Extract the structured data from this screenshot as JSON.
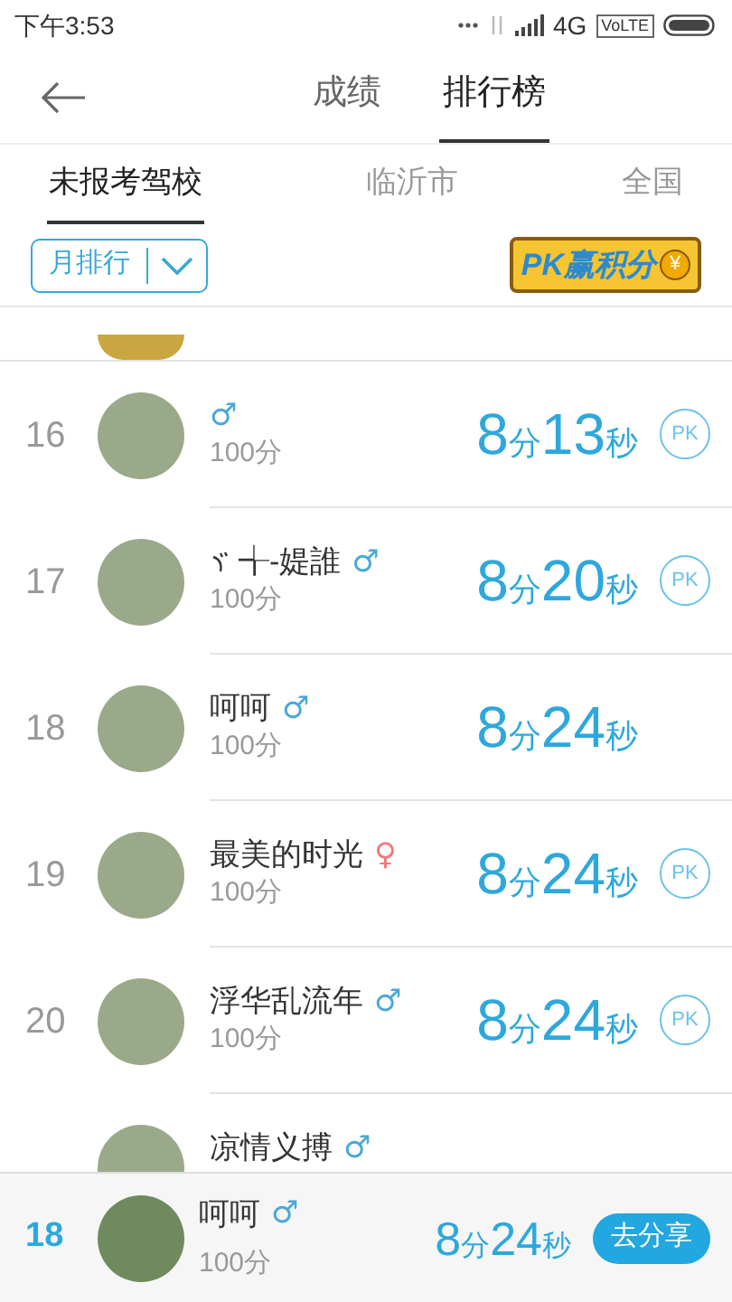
{
  "status_bar": {
    "time": "下午3:53",
    "network": "4G",
    "volte": "VoLTE"
  },
  "header": {
    "tabs": [
      {
        "label": "成绩",
        "selected": false
      },
      {
        "label": "排行榜",
        "selected": true
      }
    ]
  },
  "scope_tabs": [
    {
      "label": "未报考驾校",
      "selected": true
    },
    {
      "label": "临沂市",
      "selected": false
    },
    {
      "label": "全国",
      "selected": false
    }
  ],
  "filter": {
    "label": "月排行"
  },
  "promo": {
    "text": "PK赢积分",
    "coin": "¥"
  },
  "rows": [
    {
      "rank": "16",
      "gender": {
        "symbol": "♂",
        "color": "#4aa8d8"
      },
      "score": "100分",
      "time": "8分13秒",
      "pk": "PK"
    },
    {
      "rank": "17",
      "name_symbol": true,
      "name": "╅-媞誰",
      "gender": {
        "symbol": "♂",
        "color": "#4aa8d8"
      },
      "score": "100分",
      "time": "8分20秒",
      "pk": "PK"
    },
    {
      "rank": "18",
      "name": "呵呵",
      "gender": {
        "symbol": "♂",
        "color": "#4aa8d8"
      },
      "score": "100分",
      "time": "8分24秒"
    },
    {
      "rank": "19",
      "name": "最美的时光",
      "gender": {
        "symbol": "♀",
        "color": "#f07a7a"
      },
      "score": "100分",
      "time": "8分24秒",
      "pk": "PK"
    },
    {
      "rank": "20",
      "name": "浮华乱流年",
      "gender": {
        "symbol": "♂",
        "color": "#4aa8d8"
      },
      "score": "100分",
      "time": "8分24秒",
      "pk": "PK"
    },
    {
      "name": "凉情义搏",
      "gender": {
        "symbol": "♂",
        "color": "#4aa8d8"
      }
    }
  ],
  "my_rank": {
    "rank": "18",
    "name": "呵呵",
    "gender": {
      "symbol": "♂",
      "color": "#4aa8d8"
    },
    "score": "100分",
    "time": "8分24秒",
    "button": "去分享"
  }
}
